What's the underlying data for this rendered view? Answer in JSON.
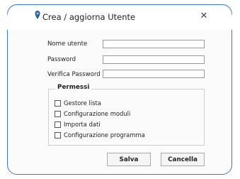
{
  "window": {
    "title": "Crea / aggiorna Utente",
    "close_glyph": "✕",
    "app_icon": "app-icon",
    "accent_color": "#3a78c2"
  },
  "form": {
    "username_label": "Nome utente",
    "username_value": "",
    "password_label": "Password",
    "password_value": "",
    "verify_label": "Verifica Password",
    "verify_value": ""
  },
  "permissions": {
    "title": "Permessi",
    "items": [
      {
        "label": "Gestore lista",
        "checked": false
      },
      {
        "label": "Configurazione moduli",
        "checked": false
      },
      {
        "label": "Importa dati",
        "checked": false
      },
      {
        "label": "Configurazione programma",
        "checked": false
      }
    ]
  },
  "buttons": {
    "save_label": "Salva",
    "cancel_label": "Cancella"
  }
}
